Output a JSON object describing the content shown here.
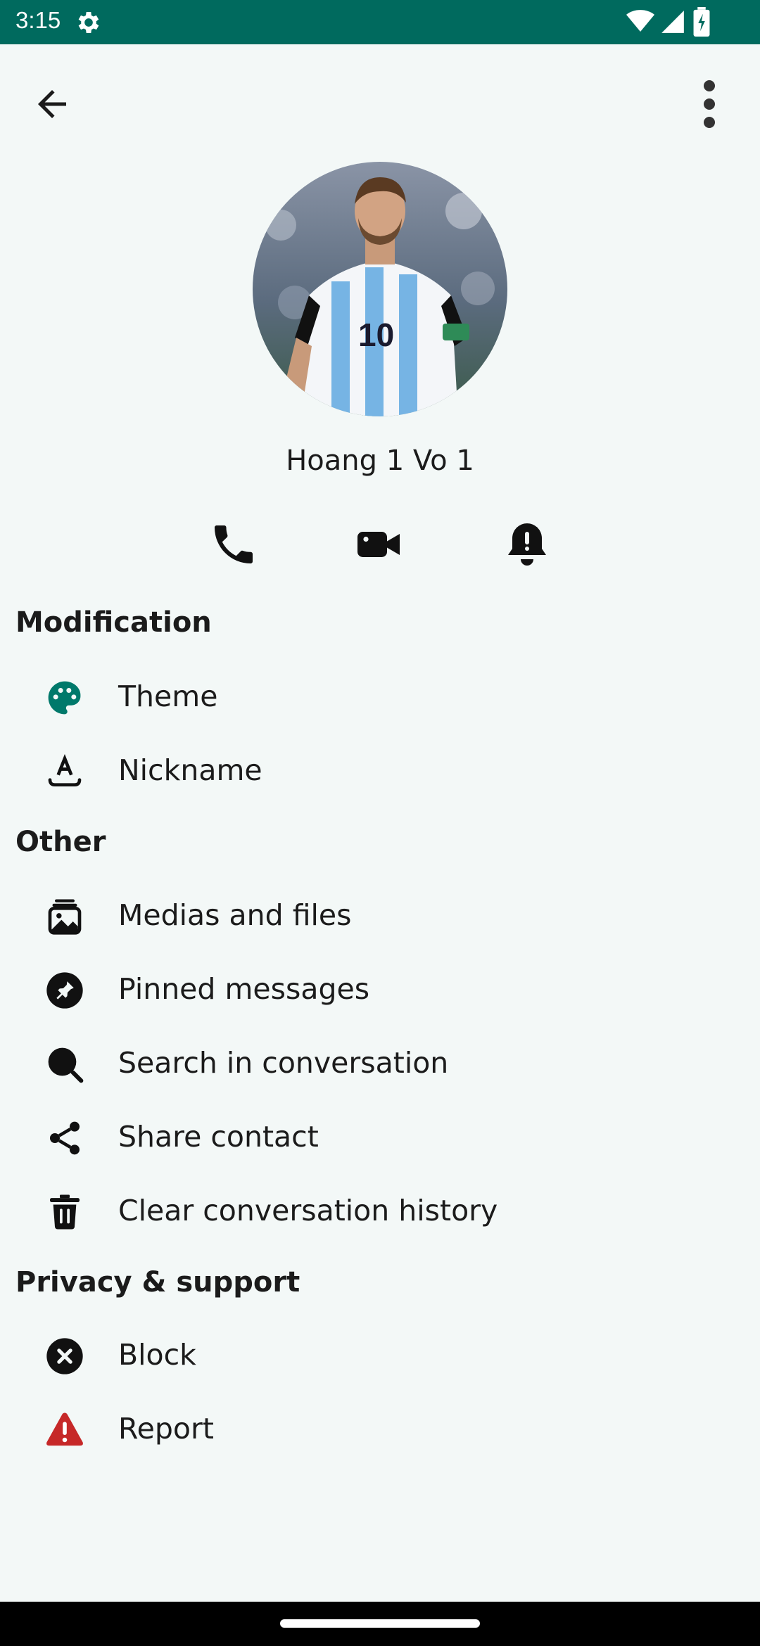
{
  "status_bar": {
    "time": "3:15",
    "icons": [
      "gear-icon",
      "wifi-icon",
      "signal-icon",
      "battery-icon"
    ]
  },
  "top_bar": {
    "back_icon": "arrow-left-icon",
    "more_icon": "more-vertical-icon"
  },
  "profile": {
    "name": "Hoang 1 Vo 1",
    "avatar_icon": "avatar-photo"
  },
  "actions": [
    {
      "icon": "phone-icon"
    },
    {
      "icon": "video-camera-icon"
    },
    {
      "icon": "bell-icon"
    }
  ],
  "sections": {
    "modification": {
      "title": "Modification",
      "items": [
        {
          "label": "Theme",
          "icon": "palette-icon"
        },
        {
          "label": "Nickname",
          "icon": "text-format-icon"
        }
      ]
    },
    "other": {
      "title": "Other",
      "items": [
        {
          "label": "Medias and files",
          "icon": "photo-library-icon"
        },
        {
          "label": "Pinned messages",
          "icon": "pin-icon"
        },
        {
          "label": "Search in conversation",
          "icon": "search-icon"
        },
        {
          "label": "Share contact",
          "icon": "share-icon"
        },
        {
          "label": "Clear conversation history",
          "icon": "trash-icon"
        }
      ]
    },
    "privacy": {
      "title": "Privacy & support",
      "items": [
        {
          "label": "Block",
          "icon": "block-icon"
        },
        {
          "label": "Report",
          "icon": "warning-icon"
        }
      ]
    }
  },
  "colors": {
    "status_bar": "#006a5e",
    "background": "#f3f8f7",
    "theme_accent": "#00796b",
    "report_red": "#c62828"
  }
}
